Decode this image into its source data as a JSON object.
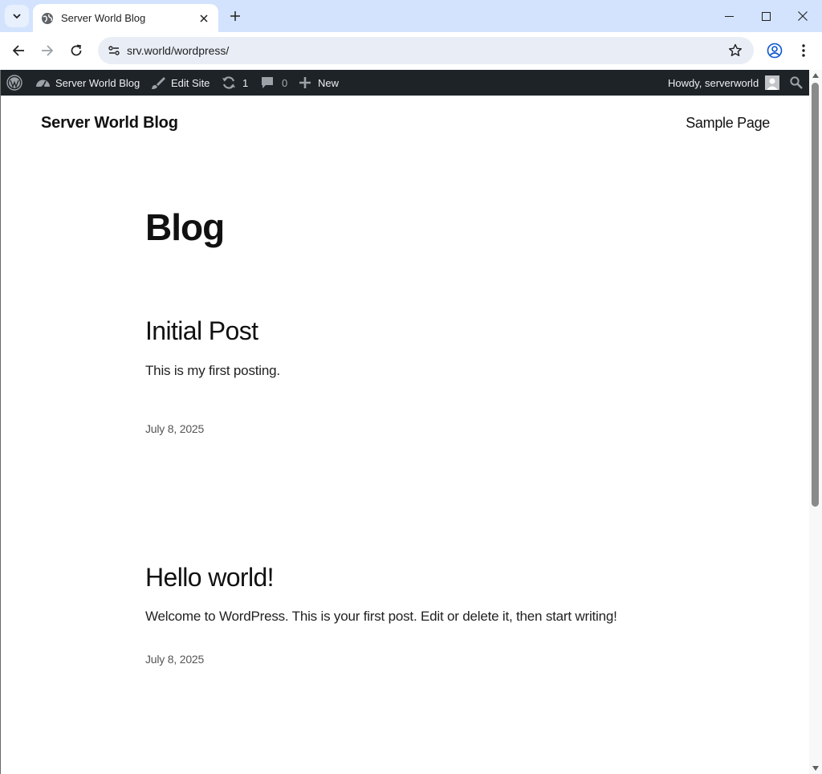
{
  "browser": {
    "tab_title": "Server World Blog",
    "url": "srv.world/wordpress/"
  },
  "admin_bar": {
    "site_name": "Server World Blog",
    "edit_site": "Edit Site",
    "updates_count": "1",
    "comments_count": "0",
    "new_label": "New",
    "howdy": "Howdy, serverworld"
  },
  "site": {
    "title": "Server World Blog",
    "nav": [
      "Sample Page"
    ]
  },
  "main": {
    "heading": "Blog",
    "posts": [
      {
        "title": "Initial Post",
        "excerpt": "This is my first posting.",
        "date": "July 8, 2025"
      },
      {
        "title": "Hello world!",
        "excerpt": "Welcome to WordPress. This is your first post. Edit or delete it, then start writing!",
        "date": "July 8, 2025"
      }
    ]
  },
  "colors": {
    "titlebar": "#d3e3fd",
    "admin_bar": "#1d2327",
    "omnibox": "#e9eef6"
  },
  "icons": [
    "tab-search-icon",
    "globe-icon",
    "close-icon",
    "plus-icon",
    "minimize-icon",
    "maximize-icon",
    "back-icon",
    "forward-icon",
    "reload-icon",
    "site-info-icon",
    "star-icon",
    "profile-icon",
    "menu-icon",
    "wordpress-logo-icon",
    "dashboard-icon",
    "brush-icon",
    "updates-icon",
    "comment-icon",
    "search-icon"
  ]
}
